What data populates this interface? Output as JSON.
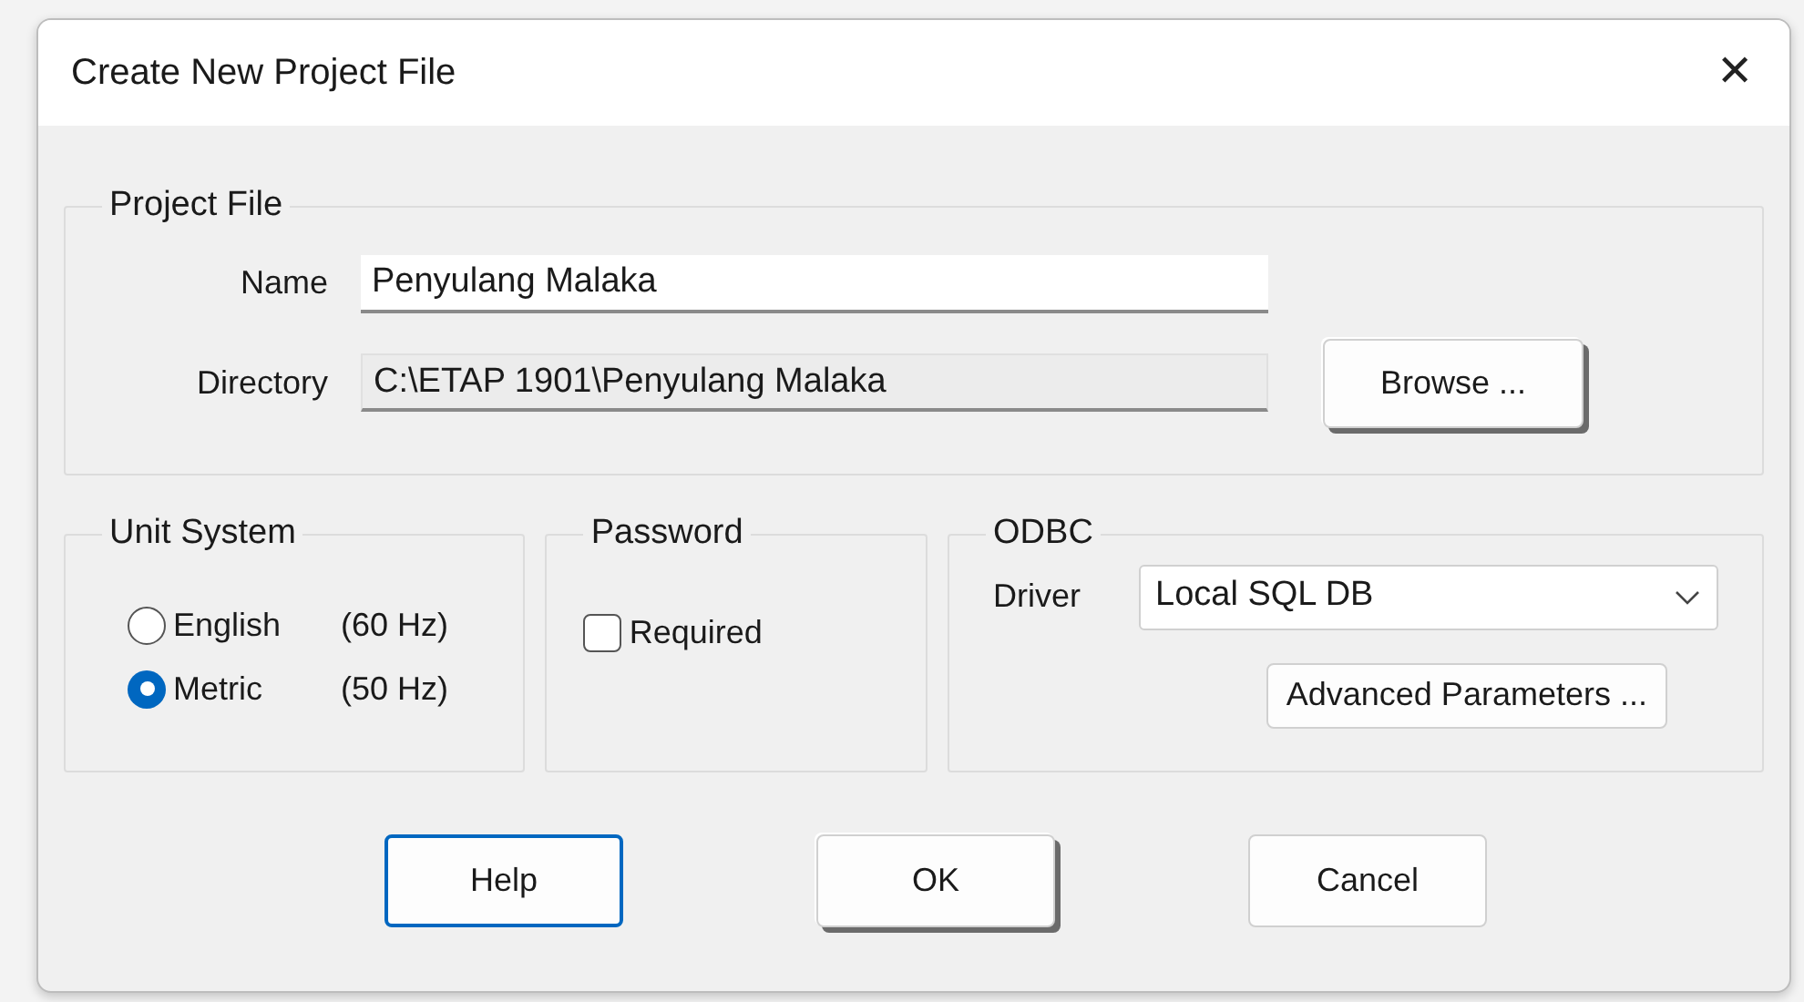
{
  "window": {
    "title": "Create New Project File",
    "close": "✕"
  },
  "project_file": {
    "title": "Project File",
    "name_label": "Name",
    "name_value": "Penyulang Malaka",
    "directory_label": "Directory",
    "directory_value": "C:\\ETAP 1901\\Penyulang Malaka",
    "browse_button": "Browse ..."
  },
  "unit_system": {
    "title": "Unit System",
    "options": [
      {
        "label": "English",
        "frequency": "(60 Hz)",
        "selected": false
      },
      {
        "label": "Metric",
        "frequency": "(50 Hz)",
        "selected": true
      }
    ]
  },
  "password": {
    "title": "Password",
    "required": {
      "label": "Required",
      "checked": false
    }
  },
  "odbc": {
    "title": "ODBC",
    "driver_label": "Driver",
    "driver_value": "Local SQL DB",
    "advanced_button": "Advanced Parameters ..."
  },
  "buttons": [
    {
      "label": "Help",
      "kind": "focused"
    },
    {
      "label": "OK",
      "kind": "default"
    },
    {
      "label": "Cancel",
      "kind": "normal"
    }
  ]
}
